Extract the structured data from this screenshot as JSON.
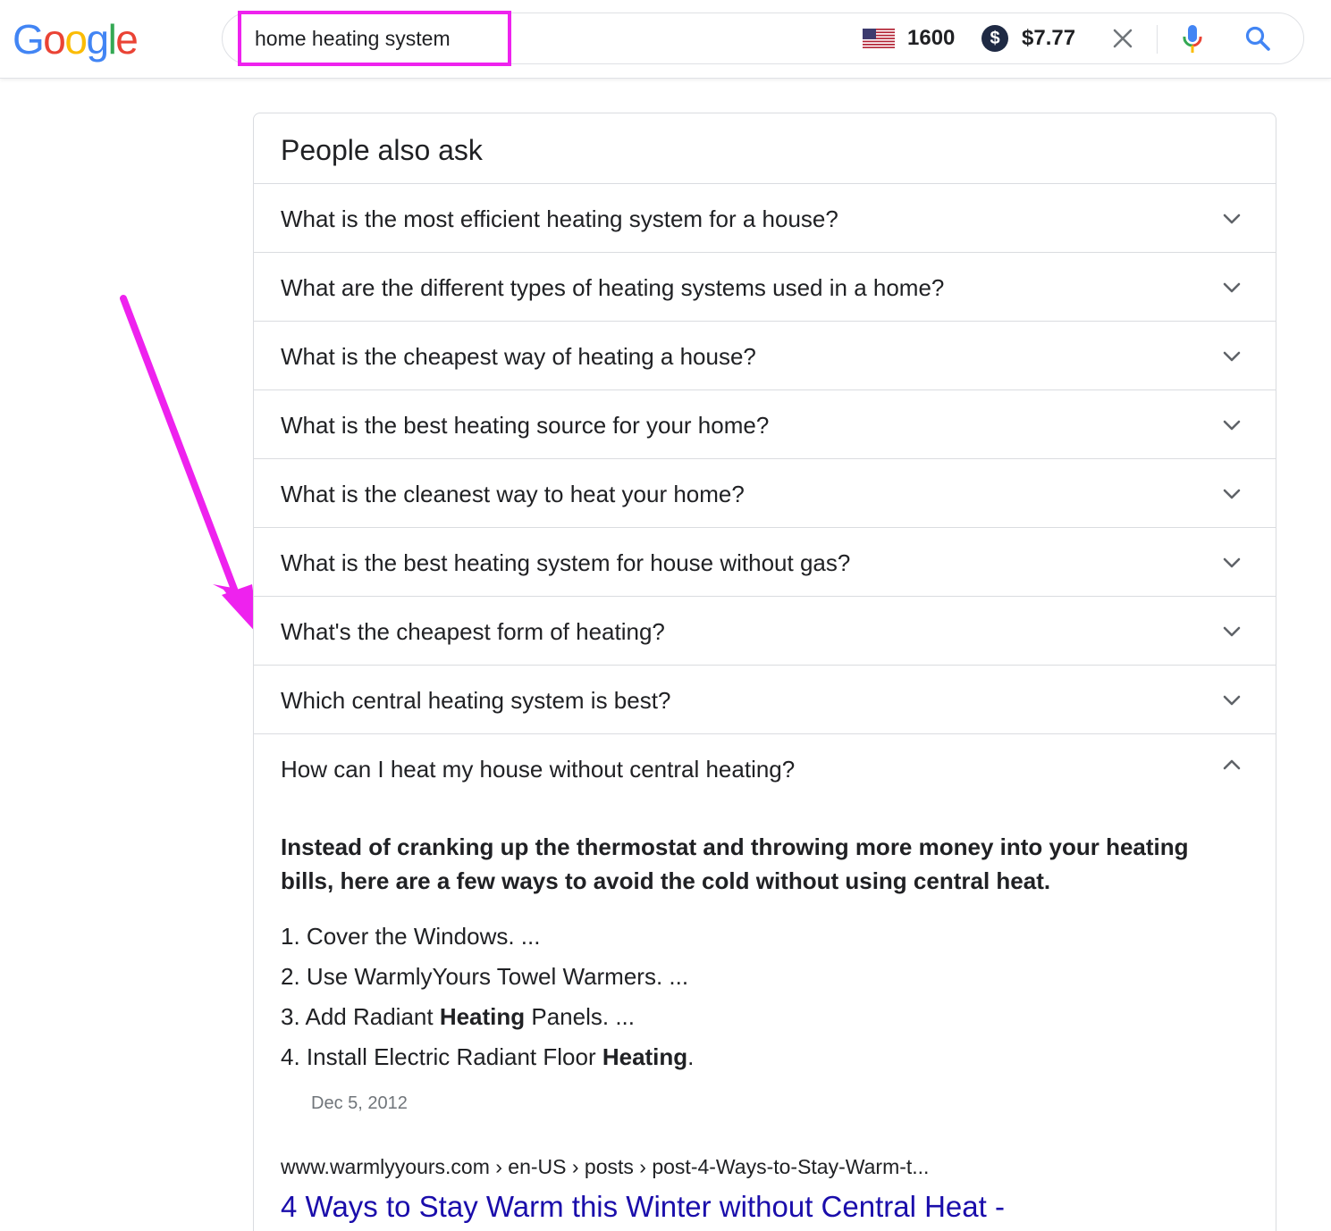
{
  "logo": {
    "letters": [
      {
        "char": "G",
        "color": "#4285F4"
      },
      {
        "char": "o",
        "color": "#EA4335"
      },
      {
        "char": "o",
        "color": "#FBBC05"
      },
      {
        "char": "g",
        "color": "#4285F4"
      },
      {
        "char": "l",
        "color": "#34A853"
      },
      {
        "char": "e",
        "color": "#EA4335"
      }
    ]
  },
  "search": {
    "query": "home heating system",
    "volume": "1600",
    "cpc": "$7.77",
    "dollar_symbol": "$",
    "highlight_color": "#ee22ee"
  },
  "paa": {
    "title": "People also ask",
    "questions": [
      "What is the most efficient heating system for a house?",
      "What are the different types of heating systems used in a home?",
      "What is the cheapest way of heating a house?",
      "What is the best heating source for your home?",
      "What is the cleanest way to heat your home?",
      "What is the best heating system for house without gas?",
      "What's the cheapest form of heating?",
      "Which central heating system is best?",
      "How can I heat my house without central heating?"
    ],
    "expanded": {
      "summary": "Instead of cranking up the thermostat and throwing more money into your heating bills, here are a few ways to avoid the cold without using central heat.",
      "list": [
        {
          "num": "1.",
          "pre": "Cover the Windows. ...",
          "bold": "",
          "post": ""
        },
        {
          "num": "2.",
          "pre": "Use WarmlyYours Towel Warmers. ...",
          "bold": "",
          "post": ""
        },
        {
          "num": "3.",
          "pre": "Add Radiant ",
          "bold": "Heating",
          "post": " Panels. ..."
        },
        {
          "num": "4.",
          "pre": "Install Electric Radiant Floor ",
          "bold": "Heating",
          "post": "."
        }
      ],
      "date": "Dec 5, 2012",
      "breadcrumb": "www.warmlyyours.com › en-US › posts › post-4-Ways-to-Stay-Warm-t...",
      "link_title": "4 Ways to Stay Warm this Winter without Central Heat -"
    }
  },
  "colors": {
    "arrow": "#ee22ee",
    "link": "#1a0dab",
    "text": "#202124",
    "muted": "#70757a"
  }
}
